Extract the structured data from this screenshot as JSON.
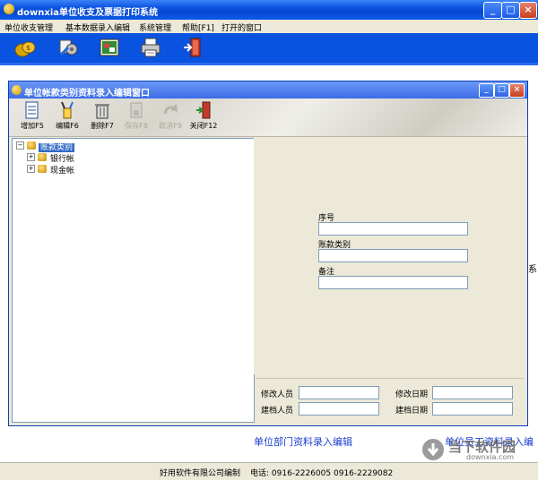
{
  "window": {
    "title": "downxia单位收支及票据打印系统",
    "minimize": "_",
    "maximize": "□",
    "close": "×"
  },
  "menu": [
    "单位收支管理",
    "基本数据录入编辑",
    "系统管理",
    "帮助[F1]",
    "打开的窗口"
  ],
  "main_toolbar": {
    "icons": [
      "money-bag-icon",
      "settings-icon",
      "picture-icon",
      "printer-icon",
      "exit-door-icon"
    ]
  },
  "inner_window": {
    "title": "单位帐款类别资料录入编辑窗口",
    "toolbar": [
      {
        "label": "增加F5",
        "icon": "add-document-icon",
        "enabled": true
      },
      {
        "label": "编辑F6",
        "icon": "edit-tools-icon",
        "enabled": true
      },
      {
        "label": "删除F7",
        "icon": "trash-icon",
        "enabled": true
      },
      {
        "label": "保存F8",
        "icon": "save-icon",
        "enabled": false
      },
      {
        "label": "取消F9",
        "icon": "undo-arrow-icon",
        "enabled": false
      },
      {
        "label": "关闭F12",
        "icon": "exit-door-icon",
        "enabled": true
      }
    ],
    "tree": {
      "root": "账款类别",
      "children": [
        "银行帐",
        "现金帐"
      ]
    },
    "form": {
      "seq_label": "序号",
      "seq_value": "",
      "category_label": "账款类别",
      "category_value": "",
      "note_label": "备注",
      "note_value": ""
    },
    "audit": {
      "modifier_label": "修改人员",
      "modify_date_label": "修改日期",
      "creator_label": "建档人员",
      "create_date_label": "建档日期"
    }
  },
  "side_mark": "系",
  "links": {
    "dept": "单位部门资料录入编辑",
    "staff": "单位员工资料录入编"
  },
  "status": {
    "company": "好用软件有限公司编制",
    "phone": "电话: 0916-2226005  0916-2229082"
  },
  "watermark": {
    "text": "当下软件园",
    "url": "downxia.com"
  }
}
